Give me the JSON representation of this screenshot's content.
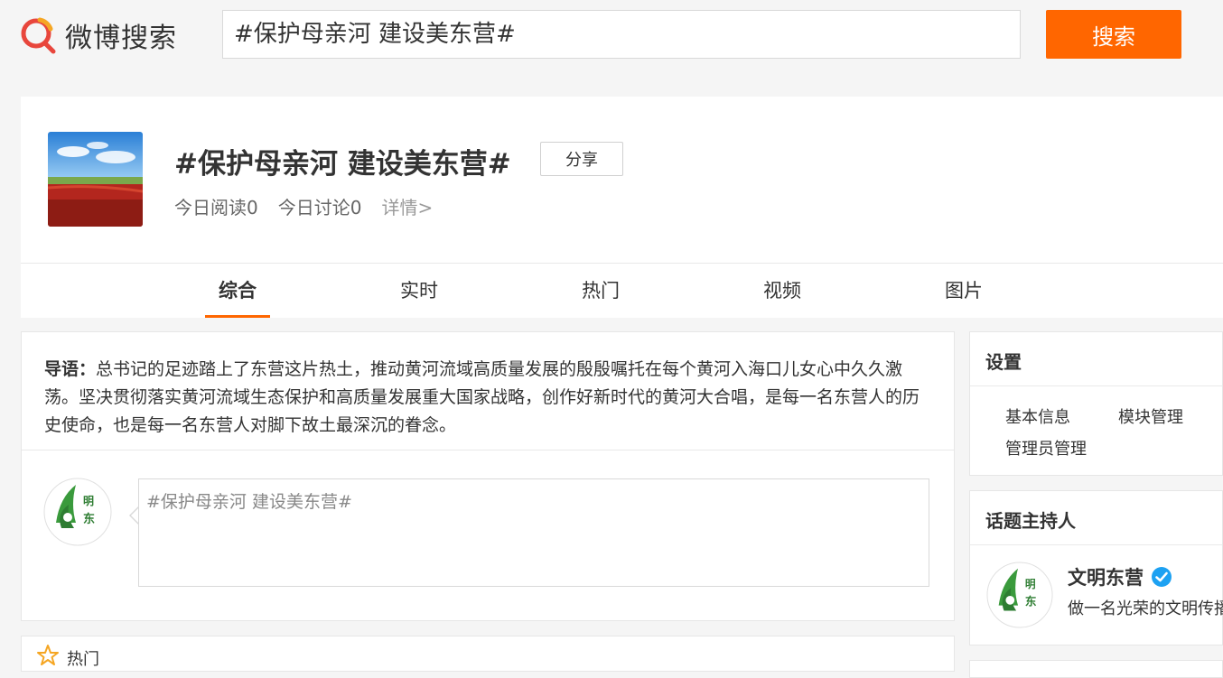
{
  "header": {
    "logo_text": "微博搜索",
    "search_value": "#保护母亲河 建设美东营#",
    "search_button": "搜索"
  },
  "topic": {
    "title": "#保护母亲河 建设美东营#",
    "share_label": "分享",
    "reads_today": "今日阅读0",
    "discussions_today": "今日讨论0",
    "details_link": "详情>"
  },
  "tabs": [
    {
      "label": "综合",
      "active": true
    },
    {
      "label": "实时",
      "active": false
    },
    {
      "label": "热门",
      "active": false
    },
    {
      "label": "视频",
      "active": false
    },
    {
      "label": "图片",
      "active": false
    }
  ],
  "intro": {
    "prefix": "导语：",
    "text": "总书记的足迹踏上了东营这片热土，推动黄河流域高质量发展的殷殷嘱托在每个黄河入海口儿女心中久久激荡。坚决贯彻落实黄河流域生态保护和高质量发展重大国家战略，创作好新时代的黄河大合唱，是每一名东营人的历史使命，也是每一名东营人对脚下故土最深沉的眷念。"
  },
  "composer": {
    "value": "#保护母亲河 建设美东营#"
  },
  "hot_section": {
    "label": "热门"
  },
  "settings": {
    "title": "设置",
    "links": [
      "基本信息",
      "模块管理",
      "管理员管理"
    ]
  },
  "host": {
    "title": "话题主持人",
    "name": "文明东营",
    "description": "做一名光荣的文明传播"
  },
  "colors": {
    "accent": "#ff6600",
    "verified": "#1da1f2",
    "logo_red": "#e8463c"
  }
}
